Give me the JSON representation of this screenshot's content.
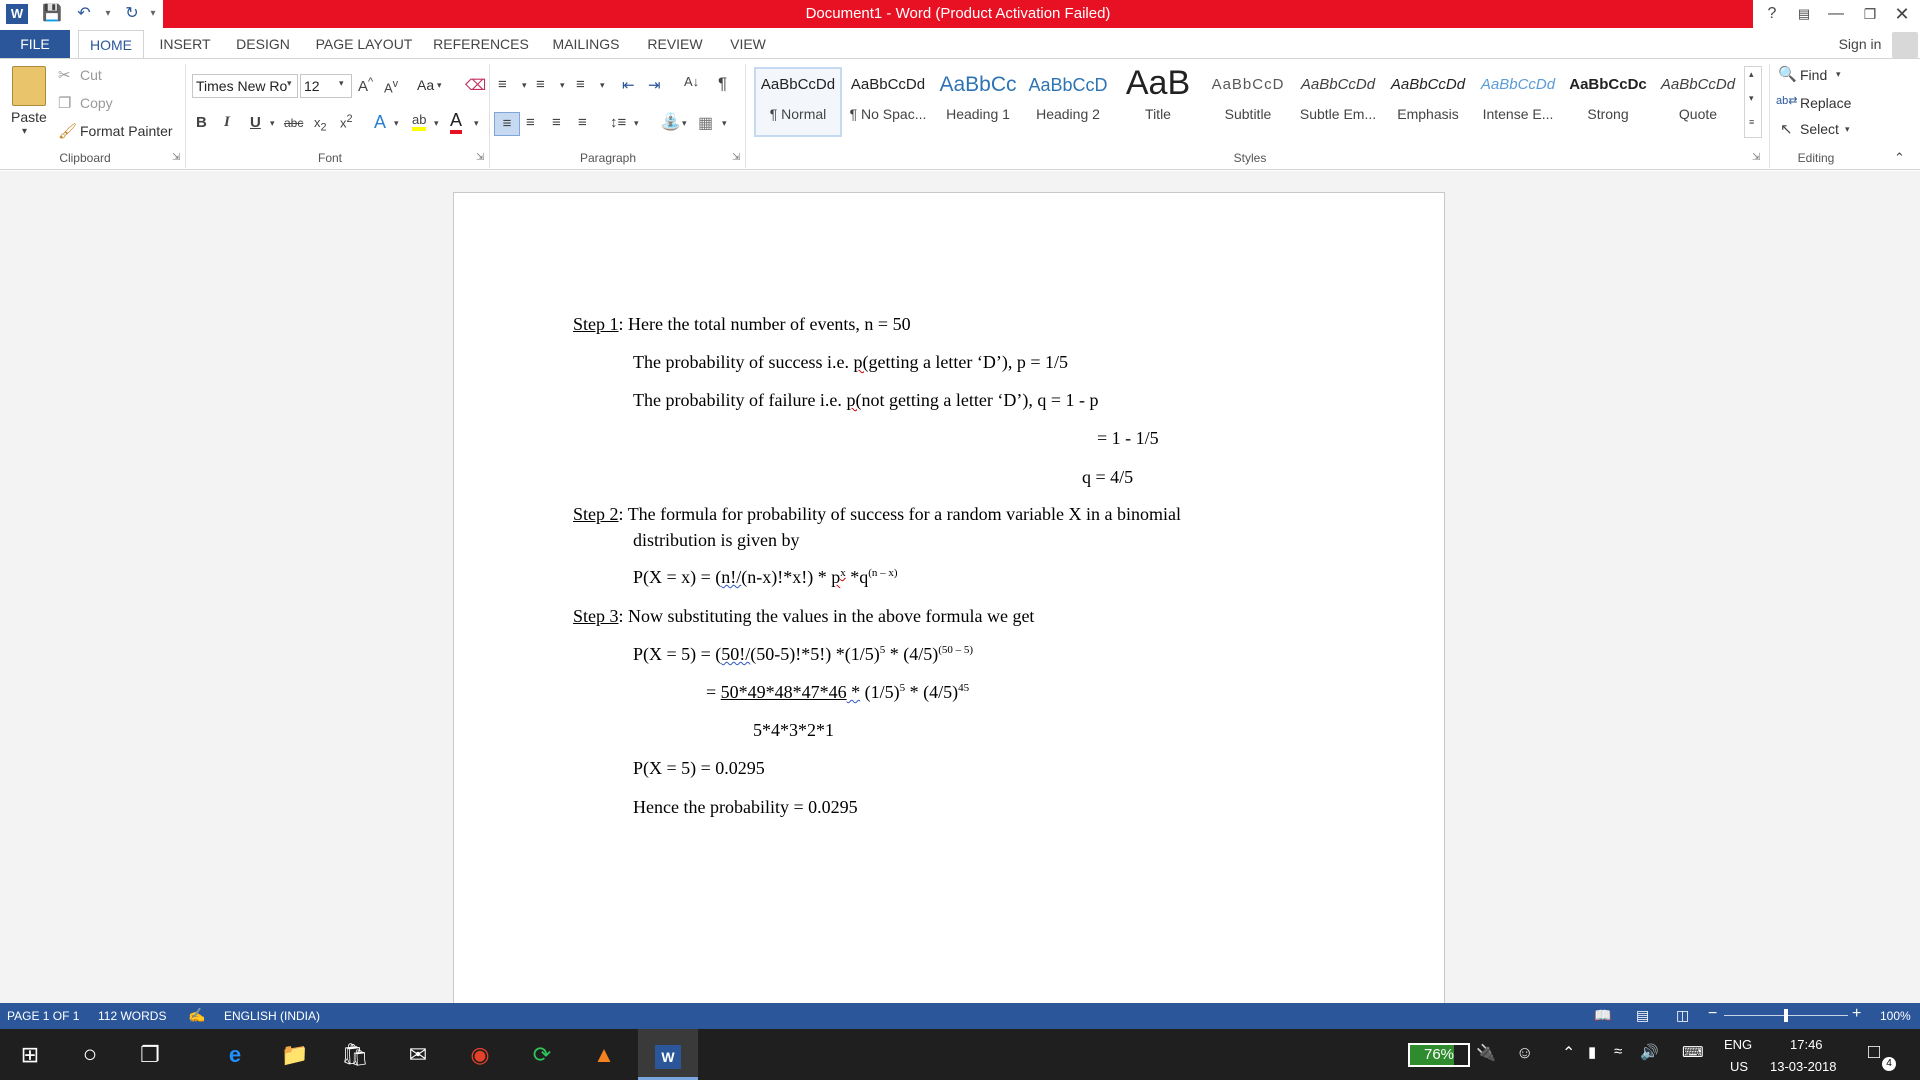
{
  "window": {
    "title": "Document1  -  Word (Product Activation Failed)",
    "help": "?",
    "sign_in": "Sign in"
  },
  "tabs": [
    "FILE",
    "HOME",
    "INSERT",
    "DESIGN",
    "PAGE LAYOUT",
    "REFERENCES",
    "MAILINGS",
    "REVIEW",
    "VIEW"
  ],
  "clipboard": {
    "paste": "Paste",
    "cut": "Cut",
    "copy": "Copy",
    "format_painter": "Format Painter",
    "label": "Clipboard"
  },
  "font": {
    "name": "Times New Ro",
    "size": "12",
    "label": "Font",
    "change_case": "Aa"
  },
  "paragraph": {
    "label": "Paragraph"
  },
  "styles": {
    "label": "Styles",
    "items": [
      {
        "preview": "AaBbCcDd",
        "name": "¶ Normal"
      },
      {
        "preview": "AaBbCcDd",
        "name": "¶ No Spac..."
      },
      {
        "preview": "AaBbCc",
        "name": "Heading 1"
      },
      {
        "preview": "AaBbCcD",
        "name": "Heading 2"
      },
      {
        "preview": "AaB",
        "name": "Title"
      },
      {
        "preview": "AaBbCcD",
        "name": "Subtitle"
      },
      {
        "preview": "AaBbCcDd",
        "name": "Subtle Em..."
      },
      {
        "preview": "AaBbCcDd",
        "name": "Emphasis"
      },
      {
        "preview": "AaBbCcDd",
        "name": "Intense E..."
      },
      {
        "preview": "AaBbCcDc",
        "name": "Strong"
      },
      {
        "preview": "AaBbCcDd",
        "name": "Quote"
      }
    ]
  },
  "editing": {
    "find": "Find",
    "replace": "Replace",
    "select": "Select",
    "label": "Editing"
  },
  "document": {
    "step1_label": "Step 1",
    "step1_text": ": Here the total number of events, n = 50",
    "success_a": "The probability of success i.e. ",
    "success_p": "p(",
    "success_b": "getting a letter ‘D’), p = 1/5",
    "failure_a": "The probability of failure i.e. ",
    "failure_p": "p(",
    "failure_b": "not getting a letter ‘D’), q = 1 - p",
    "eq1": "= 1 - 1/5",
    "eq2": "q = 4/5",
    "step2_label": "Step 2",
    "step2_text": ": The formula for probability of success for a random variable X in a binomial",
    "step2_text2": "distribution is given by",
    "formula_a": "P(X = x) = (",
    "formula_n": "n!/",
    "formula_b": "(n-x)!*x!) * ",
    "formula_p": "p",
    "formula_px": "x",
    "formula_c": " *q",
    "formula_qx": "(n – x)",
    "step3_label": "Step 3",
    "step3_text": ": Now substituting the values in the above formula we get",
    "sub1_a": "P(X = 5) = (",
    "sub1_n": "50!/",
    "sub1_b": "(50-5)!*5!) *(1/5)",
    "sub1_e1": "5",
    "sub1_c": " * (4/5)",
    "sub1_e2": "(50 – 5)",
    "sub2_pre": "= ",
    "sub2_num": "50*49*48*47*46",
    "sub2_star": "  *",
    "sub2_b": " (1/5)",
    "sub2_e1": "5",
    "sub2_c": " * (4/5)",
    "sub2_e2": "45",
    "sub2_den": "5*4*3*2*1",
    "result": "P(X = 5) = 0.0295",
    "hence": "Hence the probability  = 0.0295"
  },
  "status": {
    "page": "PAGE 1 OF 1",
    "words": "112 WORDS",
    "language": "ENGLISH (INDIA)",
    "zoom": "100%",
    "zoom_level": 100
  },
  "taskbar": {
    "battery": "76%",
    "lang1": "ENG",
    "lang2": "US",
    "time": "17:46",
    "date": "13-03-2018",
    "notif": "4"
  }
}
